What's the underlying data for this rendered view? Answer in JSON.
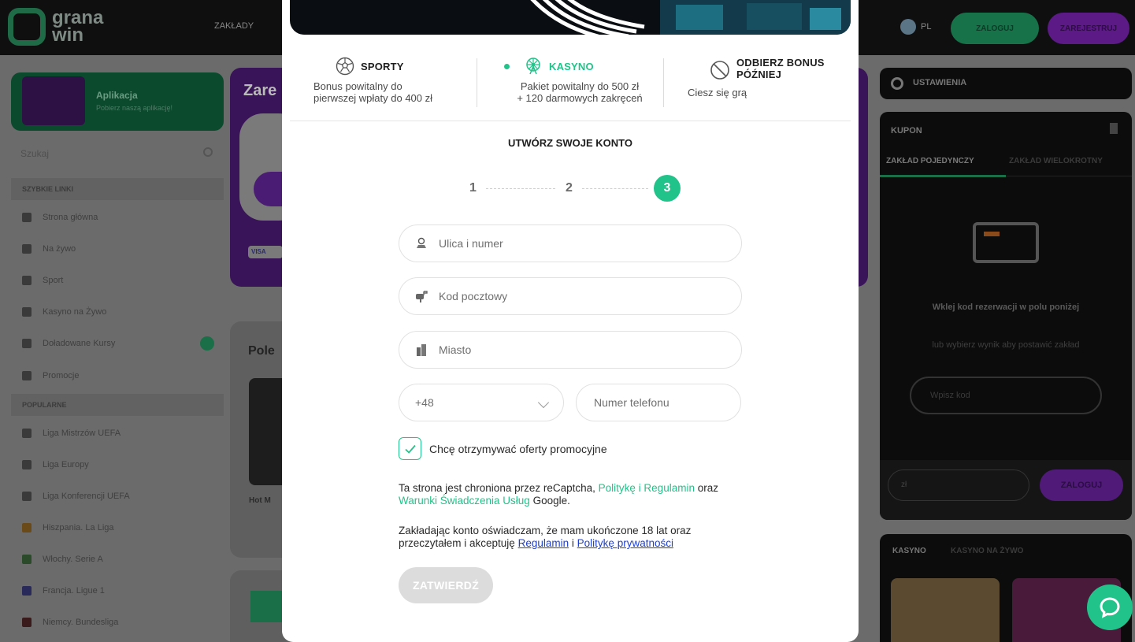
{
  "background": {
    "logo_text": "grana win",
    "top_nav_label": "ZAKŁADY",
    "lang_label": "PL",
    "login_button": "ZALOGUJ",
    "register_button": "ZAREJESTRUJ",
    "sidebar": {
      "app_title": "Aplikacja",
      "app_subtitle": "Pobierz naszą aplikację!",
      "search_placeholder": "Szukaj",
      "quick_links_header": "SZYBKIE LINKI",
      "quick_links": [
        "Strona główna",
        "Na żywo",
        "Sport",
        "Kasyno na Żywo",
        "Doładowane Kursy",
        "Promocje"
      ],
      "popular_header": "POPULARNE",
      "popular": [
        "Liga Mistrzów UEFA",
        "Liga Europy",
        "Liga Konferencji UEFA",
        "Hiszpania. La Liga",
        "Włochy. Serie A",
        "Francja. Ligue 1",
        "Niemcy. Bundesliga"
      ]
    },
    "center": {
      "promo_title": "Zare",
      "visa": "VISA",
      "section_title": "Pole",
      "game_title": "Hot M"
    },
    "right": {
      "settings_label": "USTAWIENIA",
      "coupon_title": "KUPON",
      "tab_single": "ZAKŁAD POJEDYNCZY",
      "tab_multi": "ZAKŁAD WIELOKROTNY",
      "coupon_message": "Wklej kod rezerwacji w polu poniżej",
      "coupon_message2": "lub wybierz wynik aby postawić zakład",
      "code_placeholder": "Wpisz kod",
      "stake_placeholder": "zł",
      "stake_login": "ZALOGUJ",
      "casino_tab": "KASYNO",
      "live_casino_tab": "KASYNO NA ŻYWO"
    }
  },
  "modal": {
    "bonuses": [
      {
        "title": "SPORTY",
        "desc_line1": "Bonus powitalny do",
        "desc_line2": "pierwszej wpłaty do 400 zł",
        "icon": "soccer-ball-icon"
      },
      {
        "title": "KASYNO",
        "desc_line1": "Pakiet powitalny do 500 zł",
        "desc_line2": "+ 120 darmowych zakręceń",
        "icon": "ferris-wheel-icon"
      },
      {
        "title_line1": "ODBIERZ BONUS",
        "title_line2": "PÓŹNIEJ",
        "desc_line1": "Ciesz się grą",
        "icon": "no-entry-icon"
      }
    ],
    "create_title": "UTWÓRZ SWOJE KONTO",
    "steps": [
      "1",
      "2",
      "3"
    ],
    "active_step": 3,
    "fields": {
      "street_placeholder": "Ulica i numer",
      "postal_placeholder": "Kod pocztowy",
      "city_placeholder": "Miasto",
      "phone_prefix": "+48",
      "phone_placeholder": "Numer telefonu"
    },
    "promo_checkbox_label": "Chcę otrzymywać oferty promocyjne",
    "promo_checked": true,
    "recaptcha": {
      "text1": "Ta strona jest chroniona przez reCaptcha,",
      "link1": "Politykę i Regulamin",
      "text2": "oraz",
      "link2": "Warunki Świadczenia Usług",
      "text3": "Google."
    },
    "consent": {
      "text1": "Zakładając konto oświadczam, że mam ukończone 18 lat oraz przeczytałem i akceptuję",
      "link1": "Regulamin",
      "sep": "i",
      "link2": "Politykę prywatności"
    },
    "submit_label": "ZATWIERDŹ"
  },
  "colors": {
    "accent": "#22c38a",
    "link": "#1d3fd0",
    "disabled_button": "#dcdcdc"
  }
}
